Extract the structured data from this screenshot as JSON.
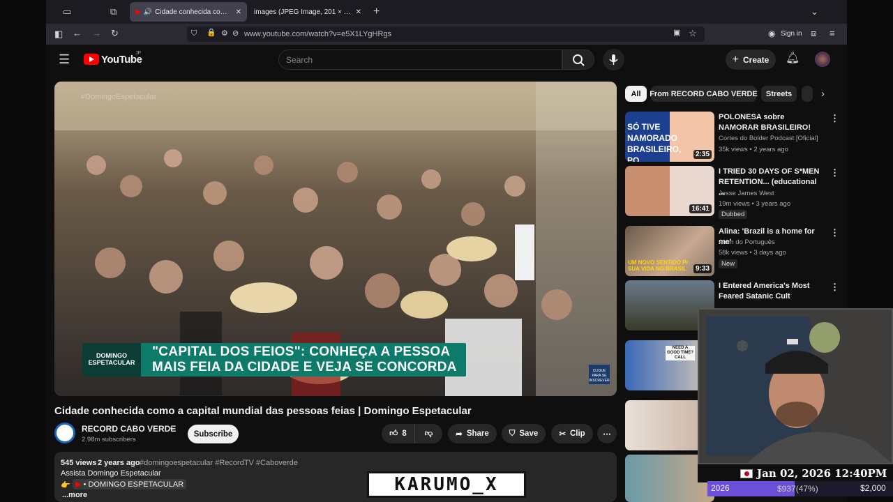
{
  "browser": {
    "tabs": [
      {
        "label": "Cidade conhecida como a capital",
        "active": true
      },
      {
        "label": "images (JPEG Image, 201 × 251 pixels)",
        "active": false
      }
    ],
    "url": "www.youtube.com/watch?v=e5X1LYgHRgs",
    "sign_in": "Sign in"
  },
  "youtube": {
    "logo_text": "YouTube",
    "region": "JP",
    "search_placeholder": "Search",
    "create_label": "Create"
  },
  "video": {
    "watermark": "#DomingoEspetacular",
    "banner_logo": [
      "DOMINGO",
      "ESPETACULAR"
    ],
    "banner_line1": "\"CAPITAL DOS FEIOS\": CONHEÇA A PESSOA",
    "banner_line2": "MAIS FEIA DA CIDADE E VEJA SE CONCORDA",
    "corner_badge": "CLIQUE PARA SE INSCREVER",
    "title": "Cidade conhecida como a capital mundial das pessoas feias | Domingo Espetacular",
    "channel": "RECORD CABO VERDE",
    "subscribers": "2.98m subscribers",
    "subscribe_label": "Subscribe",
    "likes": "8",
    "share_label": "Share",
    "save_label": "Save",
    "clip_label": "Clip",
    "views": "545 views",
    "age": "2 years ago",
    "hashtags": "#domingoespetacular #RecordTV #Caboverde",
    "desc_line1": "Assista Domingo Espetacular",
    "desc_line2": "• DOMINGO ESPETACULAR",
    "more": "...more"
  },
  "chips": [
    "All",
    "From RECORD CABO VERDE",
    "Streets"
  ],
  "related": [
    {
      "title": "POLONESA sobre NAMORAR BRASILEIRO!",
      "channel": "Cortes do Bolder Podcast [Oficial]",
      "meta": "35k views • 2 years ago",
      "duration": "2:35",
      "thumb_text": "SÓ TIVE NAMORADO BRASILEIRO, PQ",
      "badge": ""
    },
    {
      "title": "I TRIED 30 DAYS OF S*MEN RETENTION... (educational ...",
      "channel": "Jesse James West",
      "meta": "19m views • 3 years ago",
      "duration": "16:41",
      "thumb_text": "",
      "badge": "Dubbed"
    },
    {
      "title": "Alina: 'Brazil is a home for me'",
      "channel": "Além do Português",
      "meta": "58k views • 3 days ago",
      "duration": "9:33",
      "thumb_text": "UM NOVO SENTIDO P/ SUA VIDA NO BRASIL",
      "badge": "New"
    },
    {
      "title": "I Entered America's Most Feared Satanic Cult",
      "channel": "",
      "meta": "",
      "duration": "",
      "thumb_text": "",
      "badge": ""
    },
    {
      "title": "",
      "channel": "",
      "meta": "",
      "duration": "",
      "thumb_text": "NEED A GOOD TIME? CALL",
      "badge": ""
    },
    {
      "title": "",
      "channel": "",
      "meta": "",
      "duration": "1",
      "thumb_text": "",
      "badge": ""
    },
    {
      "title": "",
      "channel": "",
      "meta": "",
      "duration": "",
      "thumb_text": "",
      "badge": ""
    }
  ],
  "overlay": {
    "date": "Jan 02, 2026 12:40PM",
    "year": "2026",
    "amount": "$937(47%)",
    "goal": "$2,000",
    "progress": 0.47,
    "streamer_tag": "KARUMO_X"
  },
  "colors": {
    "accent": "#ff0000",
    "banner": "#0d7a6a",
    "progress": "#6b4fd8"
  }
}
